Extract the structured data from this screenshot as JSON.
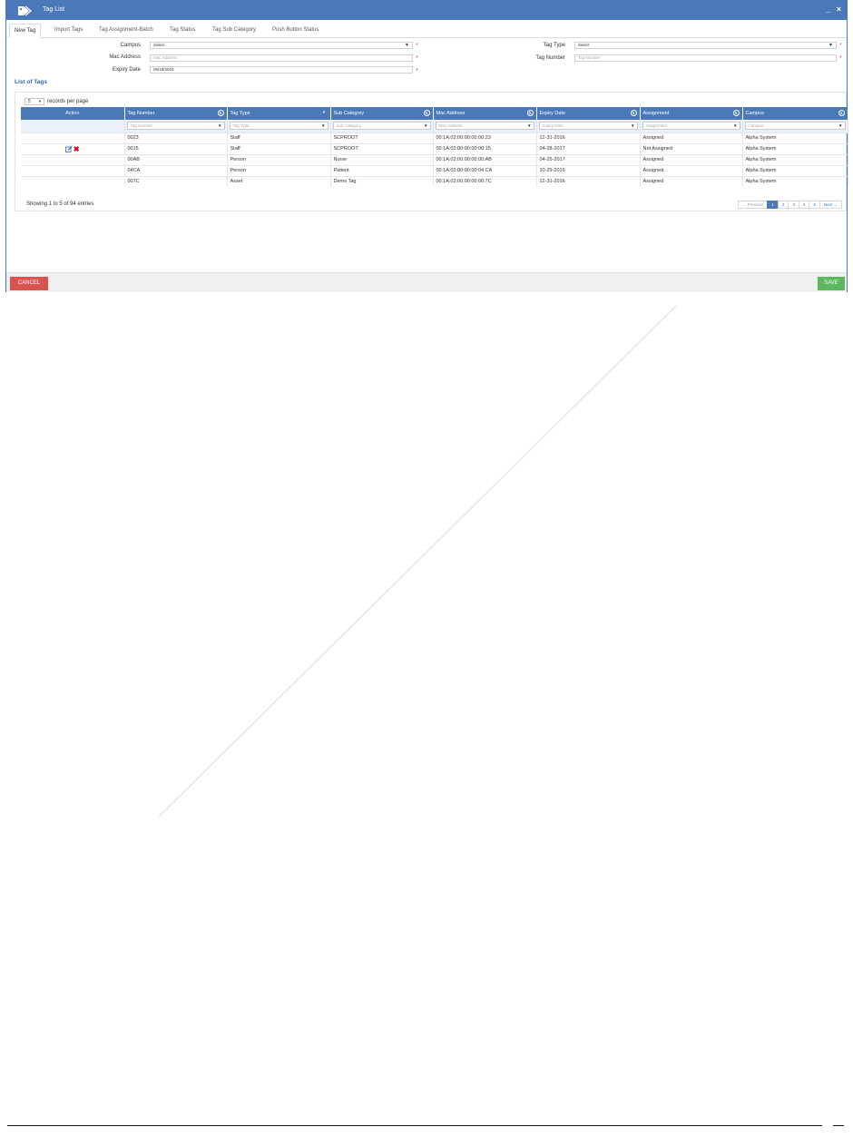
{
  "window": {
    "title": "Tag List",
    "controls": "_ ×"
  },
  "tabs": [
    {
      "label": "New Tag"
    },
    {
      "label": "Import Tags"
    },
    {
      "label": "Tag Assignment-Batch"
    },
    {
      "label": "Tag Status"
    },
    {
      "label": "Tag Sub Category"
    },
    {
      "label": "Push Button Status"
    }
  ],
  "form": {
    "campus_label": "Campus",
    "campus_value": "Select",
    "mac_label": "Mac Address",
    "mac_placeholder": "Mac Address",
    "expiry_label": "Expiry Date",
    "expiry_value": "05/18/2016",
    "tagtype_label": "Tag Type",
    "tagtype_value": "Select",
    "tagnumber_label": "Tag Number",
    "tagnumber_placeholder": "Tag Number",
    "required_mark": "*"
  },
  "list": {
    "title": "List of Tags",
    "rpp_value": "5",
    "rpp_label": "records per page",
    "columns": [
      "Action",
      "Tag Number",
      "Tag Type",
      "Sub Category",
      "Mac Address",
      "Expiry Date",
      "Assignment",
      "Campus"
    ],
    "filters": [
      "",
      "Tag Number",
      "Tag Type",
      "Sub Category",
      "Mac Address",
      "Expiry Date",
      "Assignment",
      "Campus"
    ],
    "rows": [
      [
        "0023",
        "Staff",
        "SCPROOT",
        "00:1A:02:00:00:00:00:23",
        "12-31-2016",
        "Assigned",
        "Alpha System"
      ],
      [
        "0015",
        "Staff",
        "SCPROOT",
        "00:1A:02:00:00:00:00:15",
        "04-28-2017",
        "Not Assigned",
        "Alpha System"
      ],
      [
        "00AB",
        "Person",
        "Nurse",
        "00:1A:02:00:00:00:00:AB",
        "04-25-2017",
        "Assigned",
        "Alpha System"
      ],
      [
        "04CA",
        "Person",
        "Patient",
        "00:1A:02:00:00:00:04:CA",
        "10-29-2016",
        "Assigned",
        "Alpha System"
      ],
      [
        "007C",
        "Asset",
        "Demo Tag",
        "00:1A:02:00:00:00:00:7C",
        "12-31-2016",
        "Assigned",
        "Alpha System"
      ]
    ],
    "showing": "Showing 1 to 5 of 94 entries",
    "pager": {
      "prev": "← Previous",
      "pages": [
        "1",
        "2",
        "3",
        "4",
        "5"
      ],
      "next": "Next →"
    }
  },
  "footer": {
    "cancel_label": "CANCEL",
    "save_label": "SAVE"
  },
  "colors": {
    "header_blue": "#4a78b9",
    "cancel_red": "#d9534f",
    "save_green": "#5cb85c",
    "delete_red": "#d0021b"
  },
  "icons": {
    "title": "tags-icon",
    "edit": "edit-icon",
    "delete": "delete-icon"
  }
}
